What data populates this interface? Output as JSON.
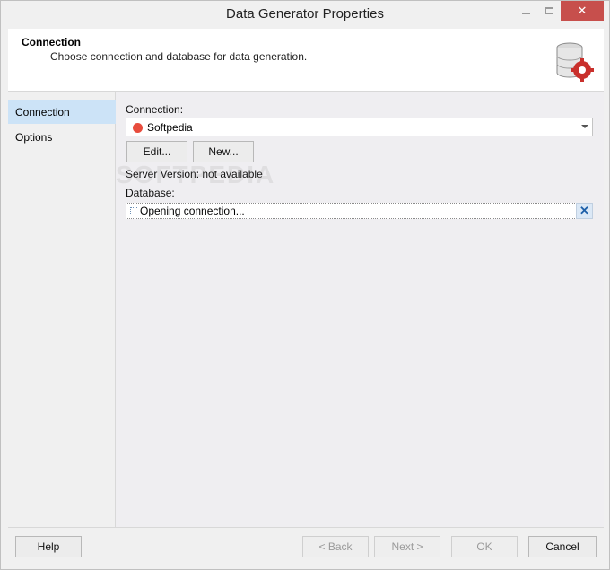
{
  "window": {
    "title": "Data Generator Properties",
    "controls": {
      "minimize": "",
      "maximize": "",
      "close": "✕"
    }
  },
  "header": {
    "title": "Connection",
    "subtitle": "Choose connection and database for data generation.",
    "icon": "database-settings-icon"
  },
  "sidebar": {
    "items": [
      {
        "label": "Connection",
        "selected": true
      },
      {
        "label": "Options",
        "selected": false
      }
    ]
  },
  "content": {
    "connection_label": "Connection:",
    "connection_value": "Softpedia",
    "connection_status_color": "#e84c3d",
    "edit_button": "Edit...",
    "new_button": "New...",
    "server_version": "Server Version: not available",
    "database_label": "Database:",
    "database_value": "Opening connection...",
    "database_cancel": "✕"
  },
  "watermark": "SOFTPEDIA",
  "footer": {
    "help": "Help",
    "back": "< Back",
    "next": "Next >",
    "ok": "OK",
    "cancel": "Cancel"
  }
}
